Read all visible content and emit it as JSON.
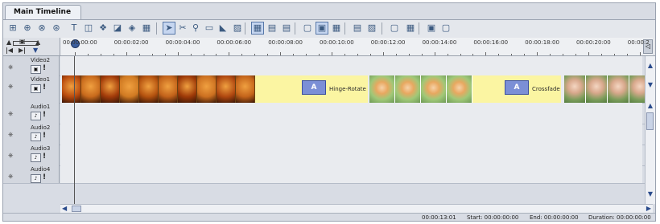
{
  "tab_title": "Main Timeline",
  "toolbar_icons": [
    "insert-track-icon",
    "split-icon",
    "group-icon",
    "ungroup-icon",
    "text-icon",
    "title-icon",
    "effect-icon",
    "transition-icon",
    "filter-icon",
    "mask-icon",
    "pointer-icon",
    "cut-icon",
    "zoom-icon",
    "snap-icon",
    "marker-icon",
    "keyframe-icon",
    "view-storyboard-icon",
    "view-timeline-icon",
    "view-list-icon",
    "track-layout-1-icon",
    "track-layout-2-icon",
    "track-layout-3-icon",
    "audio-mix-icon",
    "render-icon",
    "export-icon",
    "chapter-icon",
    "preview-icon",
    "loop-icon"
  ],
  "ruler": {
    "labels": [
      "00:00:00:00",
      "00:00:02:00",
      "00:00:04:00",
      "00:00:06:00",
      "00:00:08:00",
      "00:00:10:00",
      "00:00:12:00",
      "00:00:14:00",
      "00:00:16:00",
      "00:00:18:00",
      "00:00:20:00",
      "00:00:2"
    ]
  },
  "tracks": [
    {
      "name": "Video2",
      "type": "video"
    },
    {
      "name": "Video1",
      "type": "video"
    },
    {
      "name": "Audio1",
      "type": "audio"
    },
    {
      "name": "Audio2",
      "type": "audio"
    },
    {
      "name": "Audio3",
      "type": "audio"
    },
    {
      "name": "Audio4",
      "type": "audio"
    }
  ],
  "transitions": [
    {
      "label": "Hinge-Rotate",
      "glyph": "A"
    },
    {
      "label": "Crossfade",
      "glyph": "A"
    }
  ],
  "status": {
    "current": "00:00:13:01",
    "start": "Start: 00:00:00:00",
    "end": "End: 00:00:00:00",
    "duration": "Duration: 00:00:00:00"
  },
  "colors": {
    "clip_orange": "#c05a14",
    "clip_yellow": "#fbf5a2",
    "transition_blue": "#7b8fd6",
    "frame_bg": "#d8dce4"
  }
}
